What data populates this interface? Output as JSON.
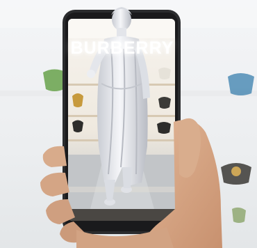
{
  "scene": {
    "storefront_sign": "BURBERRY"
  },
  "colors": {
    "background": "#eef0f2",
    "phone_body": "#2b2c2e",
    "screen_store_wall": "#f3efe8",
    "floor": "#bfc3c7",
    "statue": "#e8eaee",
    "hand": "#d6a98a",
    "shelf_bag_green": "#67a24a",
    "shelf_bag_blue": "#4f8db5",
    "shelf_bag_yellow": "#c79a3d"
  },
  "icons": [
    "smartphone",
    "statue-figure",
    "hand",
    "handbag"
  ]
}
